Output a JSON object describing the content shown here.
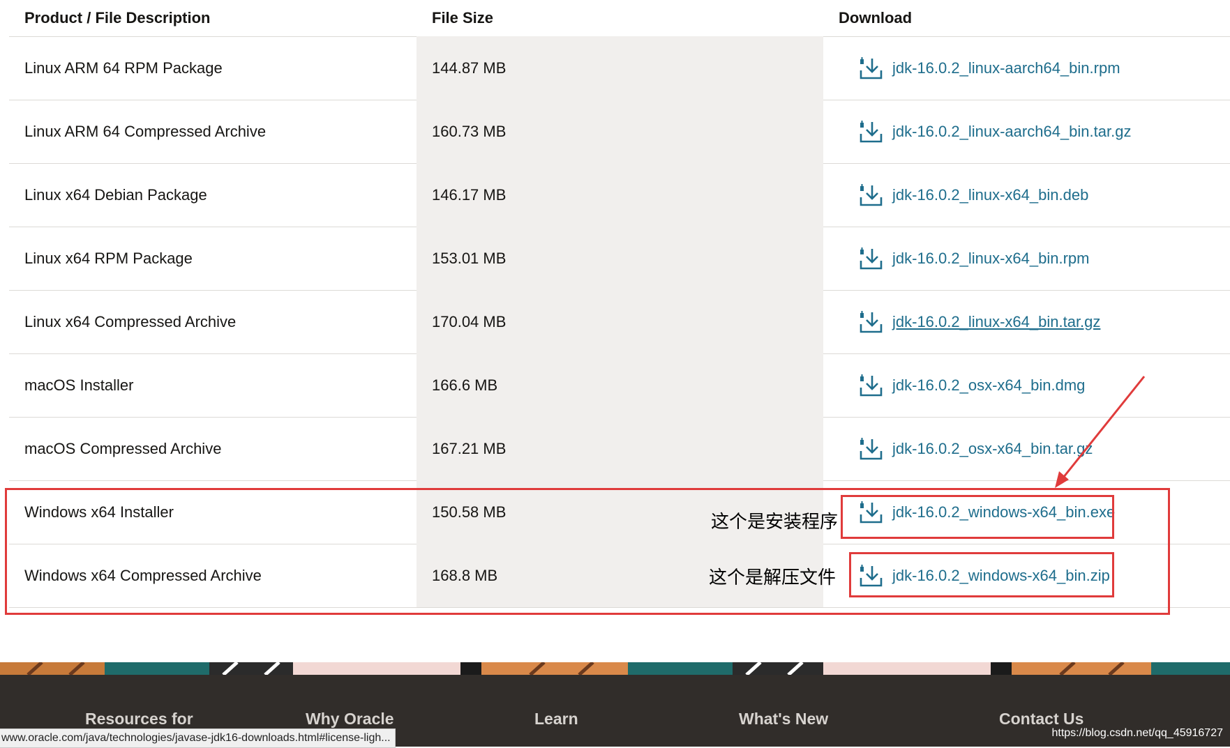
{
  "table": {
    "headers": {
      "description": "Product / File Description",
      "size": "File Size",
      "download": "Download"
    },
    "rows": [
      {
        "description": "Linux ARM 64 RPM Package",
        "size": "144.87 MB",
        "file": "jdk-16.0.2_linux-aarch64_bin.rpm"
      },
      {
        "description": "Linux ARM 64 Compressed Archive",
        "size": "160.73 MB",
        "file": "jdk-16.0.2_linux-aarch64_bin.tar.gz"
      },
      {
        "description": "Linux x64 Debian Package",
        "size": "146.17 MB",
        "file": "jdk-16.0.2_linux-x64_bin.deb"
      },
      {
        "description": "Linux x64 RPM Package",
        "size": "153.01 MB",
        "file": "jdk-16.0.2_linux-x64_bin.rpm"
      },
      {
        "description": "Linux x64 Compressed Archive",
        "size": "170.04 MB",
        "file": "jdk-16.0.2_linux-x64_bin.tar.gz"
      },
      {
        "description": "macOS Installer",
        "size": "166.6 MB",
        "file": "jdk-16.0.2_osx-x64_bin.dmg"
      },
      {
        "description": "macOS Compressed Archive",
        "size": "167.21 MB",
        "file": "jdk-16.0.2_osx-x64_bin.tar.gz"
      },
      {
        "description": "Windows x64 Installer",
        "size": "150.58 MB",
        "file": "jdk-16.0.2_windows-x64_bin.exe"
      },
      {
        "description": "Windows x64 Compressed Archive",
        "size": "168.8 MB",
        "file": "jdk-16.0.2_windows-x64_bin.zip"
      }
    ]
  },
  "annotations": {
    "installer_note": "这个是安装程序",
    "archive_note": "这个是解压文件",
    "color": "#e03b3b"
  },
  "footer": {
    "items": [
      "Resources for",
      "Why Oracle",
      "Learn",
      "What's New",
      "Contact Us"
    ]
  },
  "status_bar": {
    "url": "www.oracle.com/java/technologies/javase-jdk16-downloads.html#license-ligh..."
  },
  "watermark": "https://blog.csdn.net/qq_45916727",
  "colors": {
    "link": "#1e6d8c",
    "shaded_column": "#f1efed",
    "footer_bg": "#312d2a"
  },
  "icons": {
    "download": "download-icon"
  }
}
